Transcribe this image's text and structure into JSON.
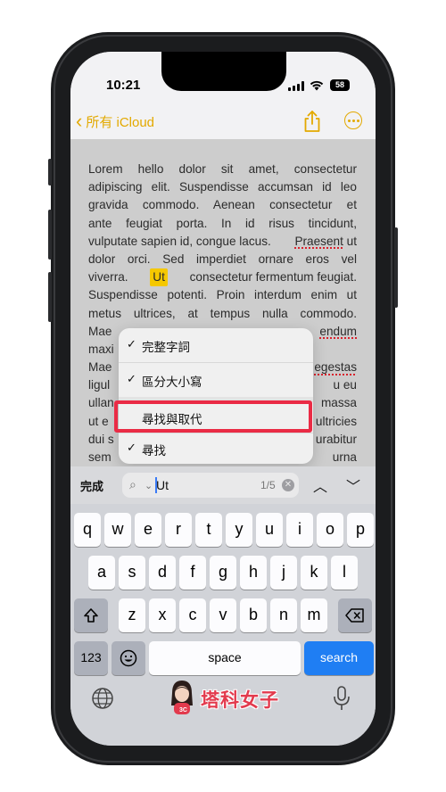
{
  "status": {
    "time": "10:21",
    "battery": "58"
  },
  "nav": {
    "back_label": "所有 iCloud"
  },
  "note": {
    "lines": [
      "Lorem hello dolor sit amet, consectetur",
      "adipiscing elit. Suspendisse accumsan id leo",
      "gravida commodo. Aenean consectetur et",
      "ante feugiat porta. In id risus tincidunt,",
      "vulputate sapien id, congue lacus.",
      "Praesent",
      "ut",
      "dolor orci. Sed imperdiet ornare eros vel",
      "viverra.",
      "Ut",
      "consectetur fermentum feugiat.",
      "Suspendisse potenti. Proin interdum enim ut",
      "metus ultrices, at tempus nulla commodo.",
      "Mae",
      "endum",
      "maxi",
      "Mae",
      "egestas",
      "ligul",
      "u eu",
      "ullan",
      "massa",
      "ut e",
      "ultricies",
      "dui s",
      "urabitur",
      "sem",
      "urna"
    ]
  },
  "find_menu": {
    "whole_words": "完整字詞",
    "match_case": "區分大小寫",
    "find_replace": "尋找與取代",
    "find": "尋找",
    "check": "✓"
  },
  "find_bar": {
    "done_label": "完成",
    "query": "Ut",
    "count": "1/5"
  },
  "keyboard": {
    "row1": [
      "q",
      "w",
      "e",
      "r",
      "t",
      "y",
      "u",
      "i",
      "o",
      "p"
    ],
    "row2": [
      "a",
      "s",
      "d",
      "f",
      "g",
      "h",
      "j",
      "k",
      "l"
    ],
    "row3": [
      "z",
      "x",
      "c",
      "v",
      "b",
      "n",
      "m"
    ],
    "numbers_label": "123",
    "space_label": "space",
    "search_label": "search",
    "watermark": "塔科女子"
  }
}
